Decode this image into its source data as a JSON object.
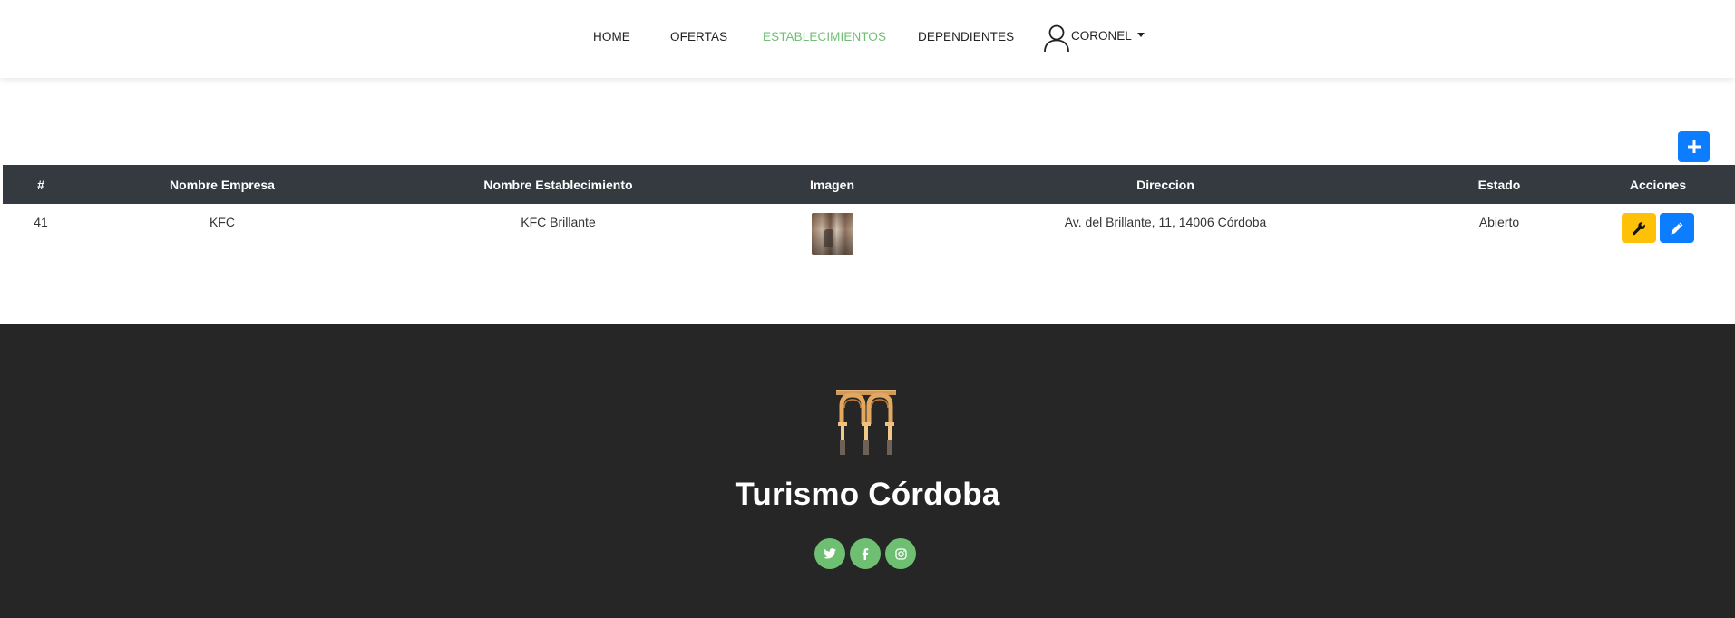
{
  "nav": {
    "items": [
      {
        "label": "HOME",
        "active": false
      },
      {
        "label": "OFERTAS",
        "active": false
      },
      {
        "label": "ESTABLECIMIENTOS",
        "active": true
      },
      {
        "label": "DEPENDIENTES",
        "active": false
      }
    ],
    "user": {
      "label": "CORONEL",
      "icon": "user-icon",
      "dropdown_icon": "caret-down-icon"
    },
    "active_color": "#6fbf73"
  },
  "toolbar": {
    "add_icon": "plus-icon",
    "add_color": "#0d7dff"
  },
  "table": {
    "headers": [
      "#",
      "Nombre Empresa",
      "Nombre Establecimiento",
      "Imagen",
      "Direccion",
      "Estado",
      "Acciones"
    ],
    "rows": [
      {
        "id": "41",
        "empresa": "KFC",
        "establecimiento": "KFC Brillante",
        "imagen": "establishment-thumbnail",
        "direccion": "Av. del Brillante, 11, 14006 Córdoba",
        "estado": "Abierto",
        "actions": [
          {
            "icon": "wrench-icon",
            "color": "#ffc107"
          },
          {
            "icon": "pencil-icon",
            "color": "#0d7dff"
          }
        ]
      }
    ],
    "header_bg": "#343a40"
  },
  "footer": {
    "logo": "mosque-arches-logo",
    "brand": "Turismo Córdoba",
    "social": [
      {
        "icon": "twitter-icon"
      },
      {
        "icon": "facebook-icon"
      },
      {
        "icon": "instagram-icon"
      }
    ],
    "bg": "#262626",
    "social_color": "#6fbf73"
  }
}
